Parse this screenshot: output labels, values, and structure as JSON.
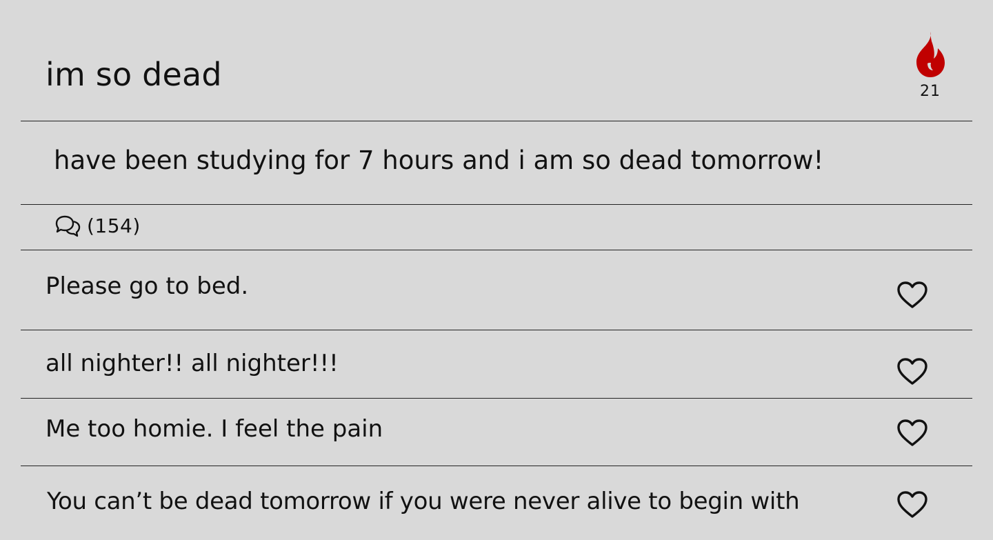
{
  "post": {
    "title": "im so dead",
    "fire_count": "21",
    "body": "have been studying for 7 hours and i am so dead tomorrow!",
    "comment_count": "(154)"
  },
  "comments": [
    {
      "text": "Please go to bed."
    },
    {
      "text": "all nighter!! all nighter!!!"
    },
    {
      "text": "Me too homie. I feel the pain"
    },
    {
      "text": "You can’t be dead tomorrow if you were never alive to begin with"
    }
  ],
  "colors": {
    "background": "#d9d9d9",
    "fire": "#c00000",
    "text": "#111111",
    "divider": "#222222"
  },
  "icons": {
    "fire": "fire-icon",
    "comments": "speech-bubbles-icon",
    "like": "heart-icon"
  }
}
